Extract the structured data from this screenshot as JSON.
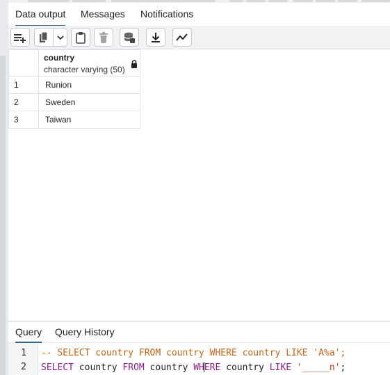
{
  "result_tabs": [
    {
      "label": "Data output",
      "active": true
    },
    {
      "label": "Messages",
      "active": false
    },
    {
      "label": "Notifications",
      "active": false
    }
  ],
  "toolbar": {
    "buttons": [
      {
        "icon": "add-row-icon",
        "enabled": true
      },
      {
        "icon": "copy-icon",
        "enabled": true
      },
      {
        "icon": "chevron-down-icon",
        "enabled": true
      },
      {
        "icon": "paste-icon",
        "enabled": true
      },
      {
        "icon": "delete-icon",
        "enabled": false
      },
      {
        "icon": "save-data-icon",
        "enabled": true
      },
      {
        "icon": "download-icon",
        "enabled": true
      },
      {
        "icon": "graph-visualiser-icon",
        "enabled": true
      }
    ]
  },
  "grid": {
    "column": {
      "name": "country",
      "type": "character varying (50)",
      "locked": true
    },
    "rows": [
      {
        "num": "1",
        "value": "Runion"
      },
      {
        "num": "2",
        "value": "Sweden"
      },
      {
        "num": "3",
        "value": "Taiwan"
      }
    ]
  },
  "query_tabs": [
    {
      "label": "Query",
      "active": true
    },
    {
      "label": "Query History",
      "active": false
    }
  ],
  "editor": {
    "lines": [
      {
        "num": "1",
        "comment": "-- SELECT country FROM country WHERE country LIKE 'A%a';"
      },
      {
        "num": "2",
        "kw1": "SELECT",
        "t1": " country ",
        "kw2": "FROM",
        "t2": " country ",
        "kw3a": "WH",
        "kw3b": "ERE",
        "t3": " country ",
        "kw4": "LIKE",
        "t4": " ",
        "str": "'_____n'",
        "end": ";"
      }
    ]
  },
  "colors": {
    "accent": "#326690",
    "keyword": "#8a1f8a",
    "comment": "#c0641a",
    "string": "#a2401a"
  }
}
